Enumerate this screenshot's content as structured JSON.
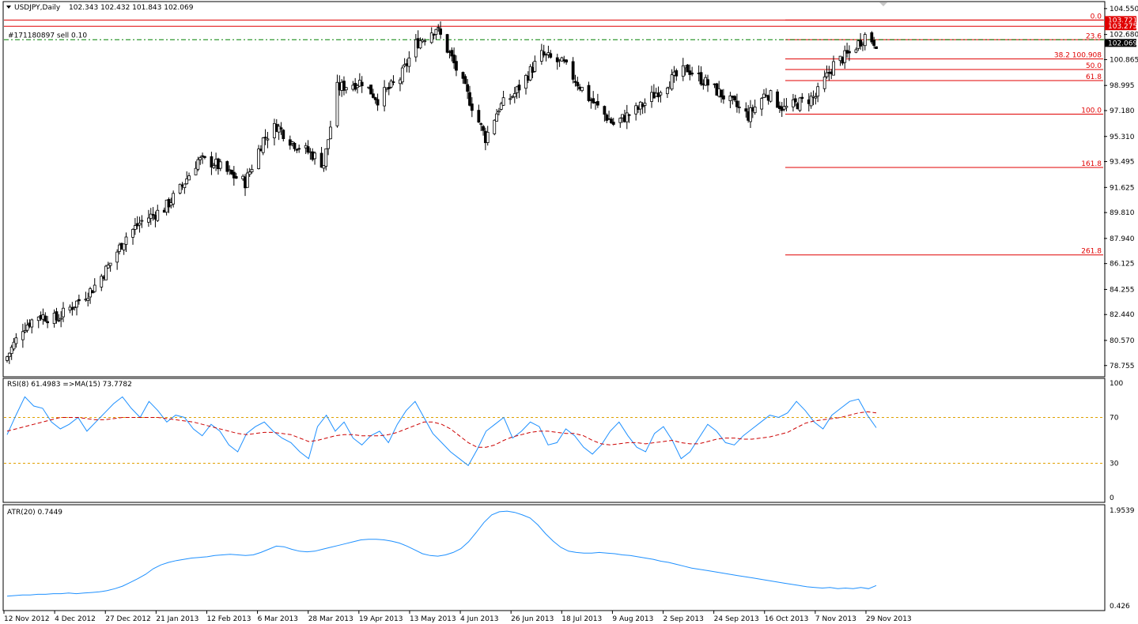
{
  "header": {
    "symbol": "USDJPY,Daily",
    "ohlc": "102.343 102.432 101.843 102.069"
  },
  "colors": {
    "candle": "#000000",
    "rsi_line": "#1e90ff",
    "rsi_ma": "#cc0000",
    "atr_line": "#1e90ff",
    "fib": "#e00000",
    "level_dashed": "#e0a000",
    "order_line": "#008000"
  },
  "order_label": "#171180897 sell 0.10",
  "chart_data": [
    {
      "type": "candlestick",
      "title": "USDJPY,Daily",
      "ylim": [
        78.0,
        105.0
      ],
      "y_ticks": [
        "104.550",
        "102.680",
        "100.865",
        "98.995",
        "97.180",
        "95.310",
        "93.495",
        "91.625",
        "89.810",
        "87.940",
        "86.125",
        "84.255",
        "82.440",
        "80.570",
        "78.755"
      ],
      "price_badges": [
        {
          "label": "103.721",
          "value": 103.721
        },
        {
          "label": "103.275",
          "value": 103.275
        },
        {
          "label": "102.069",
          "value": 102.069
        }
      ],
      "fib_levels": [
        {
          "label": "0.0",
          "value": 103.721
        },
        {
          "label": "23.6",
          "value": 102.3
        },
        {
          "label": "38.2 100.908",
          "value": 100.908
        },
        {
          "label": "50.0",
          "value": 100.15
        },
        {
          "label": "61.8",
          "value": 99.35
        },
        {
          "label": "100.0",
          "value": 96.92
        },
        {
          "label": "161.8",
          "value": 93.07
        },
        {
          "label": "261.8",
          "value": 86.75
        }
      ],
      "order_price": 102.3,
      "x_labels": [
        "12 Nov 2012",
        "4 Dec 2012",
        "27 Dec 2012",
        "21 Jan 2013",
        "12 Feb 2013",
        "6 Mar 2013",
        "28 Mar 2013",
        "19 Apr 2013",
        "13 May 2013",
        "4 Jun 2013",
        "26 Jun 2013",
        "18 Jul 2013",
        "9 Aug 2013",
        "2 Sep 2013",
        "24 Sep 2013",
        "16 Oct 2013",
        "7 Nov 2013",
        "29 Nov 2013"
      ],
      "close_anchors": [
        {
          "date": "2012-11-12",
          "close": 79.4
        },
        {
          "date": "2012-11-19",
          "close": 81.5
        },
        {
          "date": "2012-11-26",
          "close": 82.4
        },
        {
          "date": "2012-12-04",
          "close": 82.1
        },
        {
          "date": "2012-12-12",
          "close": 83.2
        },
        {
          "date": "2012-12-20",
          "close": 84.3
        },
        {
          "date": "2012-12-27",
          "close": 85.9
        },
        {
          "date": "2013-01-04",
          "close": 88.1
        },
        {
          "date": "2013-01-11",
          "close": 89.2
        },
        {
          "date": "2013-01-21",
          "close": 90.1
        },
        {
          "date": "2013-01-28",
          "close": 91.5
        },
        {
          "date": "2013-02-05",
          "close": 93.6
        },
        {
          "date": "2013-02-12",
          "close": 93.4
        },
        {
          "date": "2013-02-20",
          "close": 92.5
        },
        {
          "date": "2013-02-26",
          "close": 92.0
        },
        {
          "date": "2013-03-06",
          "close": 95.1
        },
        {
          "date": "2013-03-12",
          "close": 96.1
        },
        {
          "date": "2013-03-19",
          "close": 94.9
        },
        {
          "date": "2013-03-28",
          "close": 94.0
        },
        {
          "date": "2013-04-02",
          "close": 93.3
        },
        {
          "date": "2013-04-08",
          "close": 98.8
        },
        {
          "date": "2013-04-19",
          "close": 99.3
        },
        {
          "date": "2013-04-26",
          "close": 98.0
        },
        {
          "date": "2013-05-06",
          "close": 99.5
        },
        {
          "date": "2013-05-13",
          "close": 102.0
        },
        {
          "date": "2013-05-22",
          "close": 103.2
        },
        {
          "date": "2013-05-28",
          "close": 101.3
        },
        {
          "date": "2013-06-04",
          "close": 98.7
        },
        {
          "date": "2013-06-13",
          "close": 95.2
        },
        {
          "date": "2013-06-19",
          "close": 97.4
        },
        {
          "date": "2013-06-26",
          "close": 98.4
        },
        {
          "date": "2013-07-08",
          "close": 101.2
        },
        {
          "date": "2013-07-18",
          "close": 100.5
        },
        {
          "date": "2013-07-29",
          "close": 98.1
        },
        {
          "date": "2013-08-09",
          "close": 96.2
        },
        {
          "date": "2013-08-20",
          "close": 97.3
        },
        {
          "date": "2013-09-02",
          "close": 99.2
        },
        {
          "date": "2013-09-11",
          "close": 100.2
        },
        {
          "date": "2013-09-24",
          "close": 98.6
        },
        {
          "date": "2013-10-08",
          "close": 96.8
        },
        {
          "date": "2013-10-16",
          "close": 98.5
        },
        {
          "date": "2013-10-24",
          "close": 97.3
        },
        {
          "date": "2013-11-07",
          "close": 98.2
        },
        {
          "date": "2013-11-15",
          "close": 100.5
        },
        {
          "date": "2013-11-22",
          "close": 101.3
        },
        {
          "date": "2013-11-29",
          "close": 102.6
        },
        {
          "date": "2013-12-04",
          "close": 102.1
        }
      ]
    },
    {
      "type": "line",
      "title": "RSI(8) 61.4983 =>MA(15) 73.7782",
      "ylim": [
        0,
        100
      ],
      "y_ticks": [
        "100",
        "70",
        "30",
        "0"
      ],
      "levels": [
        70,
        30
      ],
      "series": [
        {
          "values": [
            55,
            72,
            88,
            80,
            78,
            66,
            60,
            64,
            70,
            58,
            66,
            74,
            82,
            88,
            78,
            70,
            84,
            76,
            66,
            72,
            70,
            60,
            54,
            64,
            58,
            46,
            40,
            56,
            62,
            66,
            58,
            52,
            48,
            40,
            34,
            62,
            72,
            58,
            66,
            52,
            46,
            54,
            58,
            48,
            64,
            76,
            84,
            70,
            56,
            48,
            40,
            34,
            28,
            42,
            58,
            64,
            70,
            52,
            58,
            66,
            62,
            46,
            48,
            60,
            54,
            44,
            38,
            46,
            58,
            66,
            54,
            44,
            40,
            56,
            62,
            50,
            34,
            40,
            52,
            64,
            58,
            48,
            46,
            54,
            60,
            66,
            72,
            70,
            74,
            84,
            76,
            66,
            60,
            72,
            78,
            84,
            86,
            72,
            61
          ]
        },
        {
          "values": [
            58,
            60,
            62,
            64,
            66,
            68,
            70,
            70,
            70,
            69,
            68,
            68,
            69,
            70,
            70,
            70,
            70,
            70,
            69,
            68,
            67,
            66,
            64,
            62,
            60,
            58,
            56,
            55,
            56,
            57,
            57,
            56,
            55,
            52,
            49,
            50,
            52,
            54,
            55,
            55,
            54,
            54,
            54,
            55,
            57,
            60,
            63,
            66,
            66,
            64,
            60,
            54,
            48,
            44,
            44,
            46,
            50,
            53,
            55,
            57,
            58,
            58,
            57,
            56,
            56,
            54,
            50,
            47,
            46,
            47,
            48,
            48,
            47,
            48,
            49,
            50,
            48,
            47,
            47,
            49,
            51,
            52,
            52,
            51,
            51,
            52,
            53,
            55,
            57,
            61,
            65,
            67,
            68,
            69,
            70,
            72,
            74,
            75,
            74
          ]
        }
      ]
    },
    {
      "type": "line",
      "title": "ATR(20) 0.7449",
      "ylim": [
        0.426,
        1.9539
      ],
      "y_ticks": [
        "1.9539",
        "0.426"
      ],
      "series": [
        {
          "values": [
            0.58,
            0.59,
            0.6,
            0.6,
            0.61,
            0.61,
            0.62,
            0.62,
            0.63,
            0.62,
            0.63,
            0.64,
            0.65,
            0.67,
            0.7,
            0.74,
            0.8,
            0.86,
            0.93,
            1.02,
            1.08,
            1.12,
            1.15,
            1.17,
            1.19,
            1.2,
            1.21,
            1.23,
            1.24,
            1.25,
            1.24,
            1.23,
            1.24,
            1.28,
            1.33,
            1.38,
            1.37,
            1.33,
            1.3,
            1.29,
            1.3,
            1.33,
            1.36,
            1.39,
            1.42,
            1.45,
            1.48,
            1.49,
            1.49,
            1.48,
            1.46,
            1.43,
            1.38,
            1.32,
            1.26,
            1.23,
            1.22,
            1.24,
            1.28,
            1.34,
            1.45,
            1.6,
            1.76,
            1.88,
            1.93,
            1.94,
            1.92,
            1.88,
            1.83,
            1.72,
            1.58,
            1.46,
            1.36,
            1.3,
            1.28,
            1.27,
            1.27,
            1.28,
            1.27,
            1.26,
            1.24,
            1.23,
            1.21,
            1.19,
            1.17,
            1.14,
            1.12,
            1.09,
            1.06,
            1.03,
            1.01,
            0.99,
            0.97,
            0.95,
            0.93,
            0.91,
            0.89,
            0.87,
            0.85,
            0.83,
            0.81,
            0.79,
            0.77,
            0.75,
            0.73,
            0.72,
            0.71,
            0.72,
            0.7,
            0.71,
            0.7,
            0.72,
            0.7,
            0.75
          ]
        }
      ]
    }
  ]
}
